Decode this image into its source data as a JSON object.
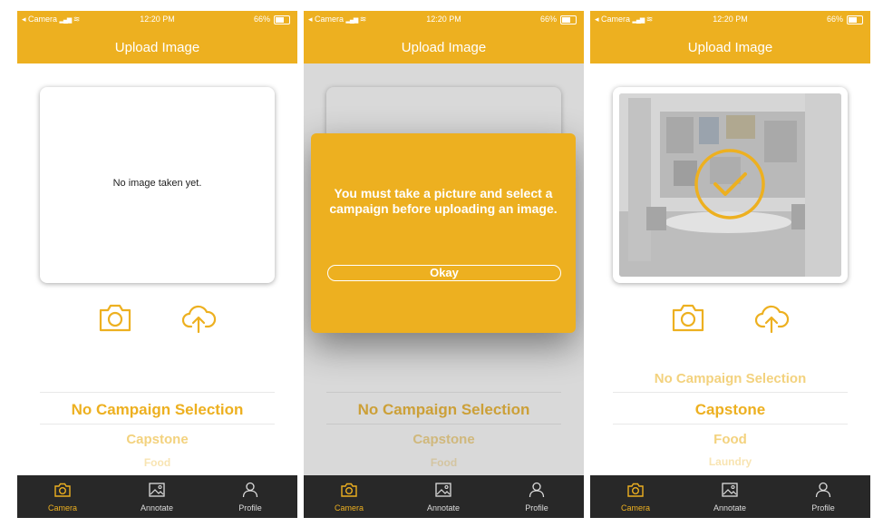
{
  "colors": {
    "accent": "#EDB020",
    "tabbar": "#282828"
  },
  "status_bar": {
    "carrier": "◂ Camera",
    "time": "12:20 PM",
    "battery": "66%"
  },
  "header": {
    "title": "Upload Image"
  },
  "screen1": {
    "empty_text": "No image taken yet.",
    "picker": {
      "selected": "No Campaign Selection",
      "next1": "Capstone",
      "next2": "Food"
    }
  },
  "screen2": {
    "modal_message": "You must take a picture and select a campaign before uploading an image.",
    "okay_label": "Okay",
    "picker": {
      "selected": "No Campaign Selection",
      "next1": "Capstone",
      "next2": "Food"
    }
  },
  "screen3": {
    "picker": {
      "prev": "No Campaign Selection",
      "selected": "Capstone",
      "next1": "Food",
      "next2": "Laundry"
    }
  },
  "tabs": [
    {
      "label": "Camera",
      "icon": "camera-icon"
    },
    {
      "label": "Annotate",
      "icon": "image-icon"
    },
    {
      "label": "Profile",
      "icon": "person-icon"
    }
  ],
  "icons": {
    "camera_button": "camera-icon",
    "upload_button": "cloud-upload-icon",
    "success": "checkmark-circle-icon"
  }
}
